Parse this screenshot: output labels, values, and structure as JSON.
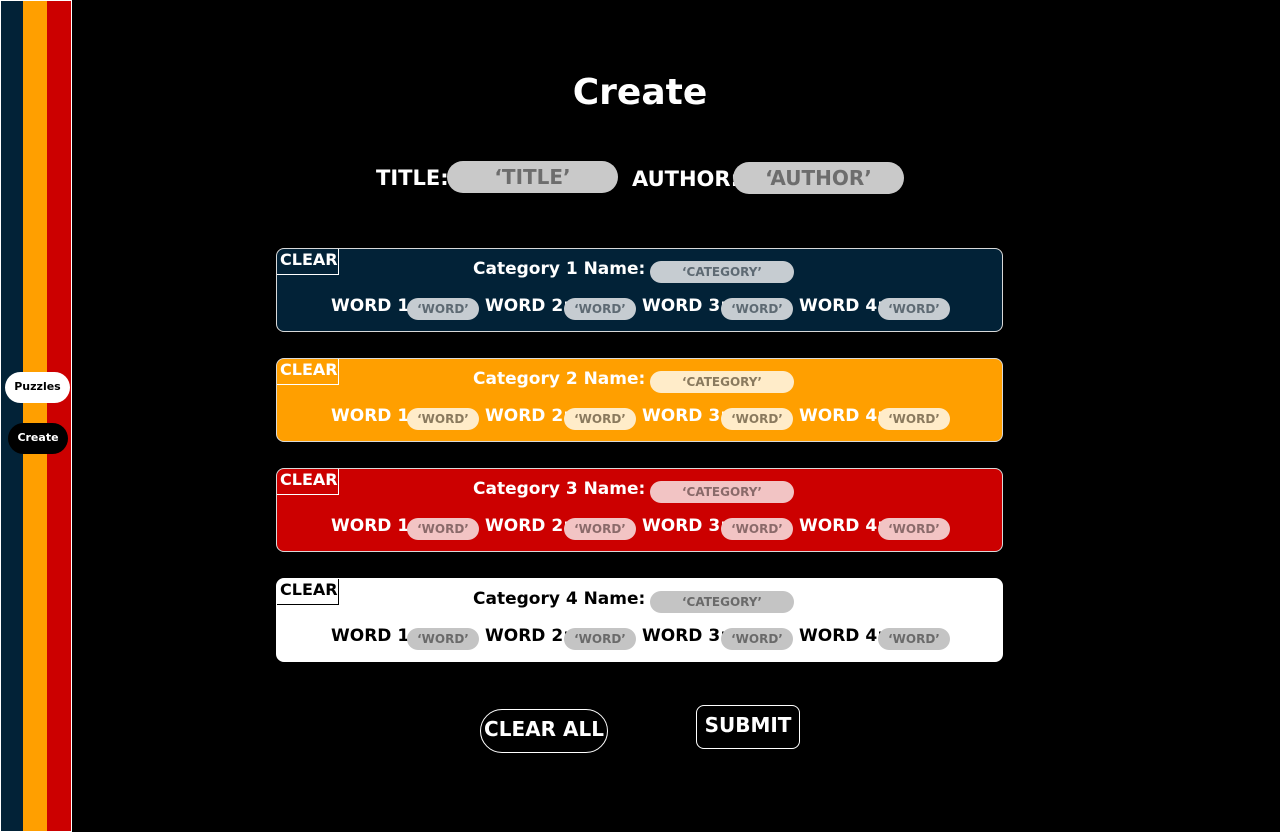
{
  "nav": {
    "puzzles_label": "Puzzles",
    "create_label": "Create"
  },
  "header": {
    "title": "Create"
  },
  "meta": {
    "title_label": "TITLE:",
    "title_placeholder": "‘TITLE’",
    "author_label": "AUTHOR:",
    "author_placeholder": "‘AUTHOR’"
  },
  "colors": {
    "stripe_navy": "#022237",
    "stripe_orange": "#ff9f00",
    "stripe_red": "#cc0000",
    "category_1": "#022237",
    "category_2": "#ff9f00",
    "category_3": "#cc0000",
    "category_4": "#ffffff"
  },
  "categories": [
    {
      "clear_label": "CLEAR",
      "name_label": "Category 1 Name:",
      "name_placeholder": "‘CATEGORY’",
      "words": [
        {
          "label": "WORD 1:",
          "placeholder": "‘WORD’"
        },
        {
          "label": "WORD 2:",
          "placeholder": "‘WORD’"
        },
        {
          "label": "WORD 3:",
          "placeholder": "‘WORD’"
        },
        {
          "label": "WORD 4:",
          "placeholder": "‘WORD’"
        }
      ]
    },
    {
      "clear_label": "CLEAR",
      "name_label": "Category 2 Name:",
      "name_placeholder": "‘CATEGORY’",
      "words": [
        {
          "label": "WORD 1:",
          "placeholder": "‘WORD’"
        },
        {
          "label": "WORD 2:",
          "placeholder": "‘WORD’"
        },
        {
          "label": "WORD 3:",
          "placeholder": "‘WORD’"
        },
        {
          "label": "WORD 4:",
          "placeholder": "‘WORD’"
        }
      ]
    },
    {
      "clear_label": "CLEAR",
      "name_label": "Category 3 Name:",
      "name_placeholder": "‘CATEGORY’",
      "words": [
        {
          "label": "WORD 1:",
          "placeholder": "‘WORD’"
        },
        {
          "label": "WORD 2:",
          "placeholder": "‘WORD’"
        },
        {
          "label": "WORD 3:",
          "placeholder": "‘WORD’"
        },
        {
          "label": "WORD 4:",
          "placeholder": "‘WORD’"
        }
      ]
    },
    {
      "clear_label": "CLEAR",
      "name_label": "Category 4 Name:",
      "name_placeholder": "‘CATEGORY’",
      "words": [
        {
          "label": "WORD 1:",
          "placeholder": "‘WORD’"
        },
        {
          "label": "WORD 2:",
          "placeholder": "‘WORD’"
        },
        {
          "label": "WORD 3:",
          "placeholder": "‘WORD’"
        },
        {
          "label": "WORD 4:",
          "placeholder": "‘WORD’"
        }
      ]
    }
  ],
  "actions": {
    "clear_all_label": "CLEAR ALL",
    "submit_label": "SUBMIT"
  }
}
